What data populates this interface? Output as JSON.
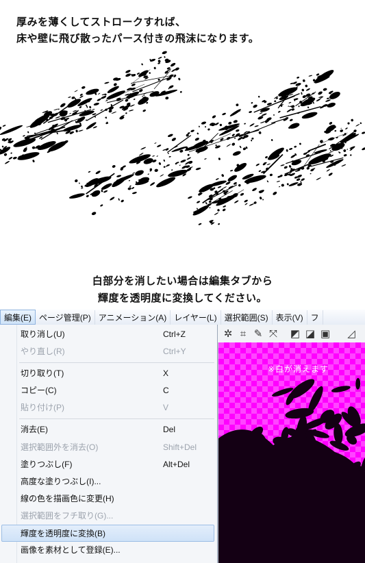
{
  "captions": {
    "top_line1": "厚みを薄くしてストロークすれば、",
    "top_line2": "床や壁に飛び散ったパース付きの飛沫になります。",
    "middle_line1": "白部分を消したい場合は編集タブから",
    "middle_line2": "輝度を透明度に変換してください。"
  },
  "menubar": {
    "items": [
      {
        "label": "編集(E)",
        "active": true
      },
      {
        "label": "ページ管理(P)"
      },
      {
        "label": "アニメーション(A)"
      },
      {
        "label": "レイヤー(L)"
      },
      {
        "label": "選択範囲(S)"
      },
      {
        "label": "表示(V)"
      },
      {
        "label": "フ"
      }
    ]
  },
  "edit_menu": {
    "items": [
      {
        "label": "取り消し(U)",
        "shortcut": "Ctrl+Z",
        "enabled": true
      },
      {
        "label": "やり直し(R)",
        "shortcut": "Ctrl+Y",
        "enabled": false,
        "separator_after": true
      },
      {
        "label": "切り取り(T)",
        "shortcut": "X",
        "enabled": true
      },
      {
        "label": "コピー(C)",
        "shortcut": "C",
        "enabled": true
      },
      {
        "label": "貼り付け(P)",
        "shortcut": "V",
        "enabled": false,
        "separator_after": true
      },
      {
        "label": "消去(E)",
        "shortcut": "Del",
        "enabled": true
      },
      {
        "label": "選択範囲外を消去(O)",
        "shortcut": "Shift+Del",
        "enabled": false
      },
      {
        "label": "塗りつぶし(F)",
        "shortcut": "Alt+Del",
        "enabled": true
      },
      {
        "label": "高度な塗りつぶし(I)...",
        "shortcut": "",
        "enabled": true
      },
      {
        "label": "線の色を描画色に変更(H)",
        "shortcut": "",
        "enabled": true
      },
      {
        "label": "選択範囲をフチ取り(G)...",
        "shortcut": "",
        "enabled": false
      },
      {
        "label": "輝度を透明度に変換(B)",
        "shortcut": "",
        "enabled": true,
        "highlighted": true
      },
      {
        "label": "画像を素材として登録(E)...",
        "shortcut": "",
        "enabled": true
      }
    ]
  },
  "canvas": {
    "note": "※白が消えます",
    "transparency_color": "#ff00ff"
  },
  "toolbar_icons": [
    "sparkle-select-icon",
    "crop-frame-icon",
    "pen-tool-icon",
    "transform-icon",
    "flip-icon",
    "gradient-icon",
    "frame-icon",
    "perspective-ruler-icon"
  ]
}
